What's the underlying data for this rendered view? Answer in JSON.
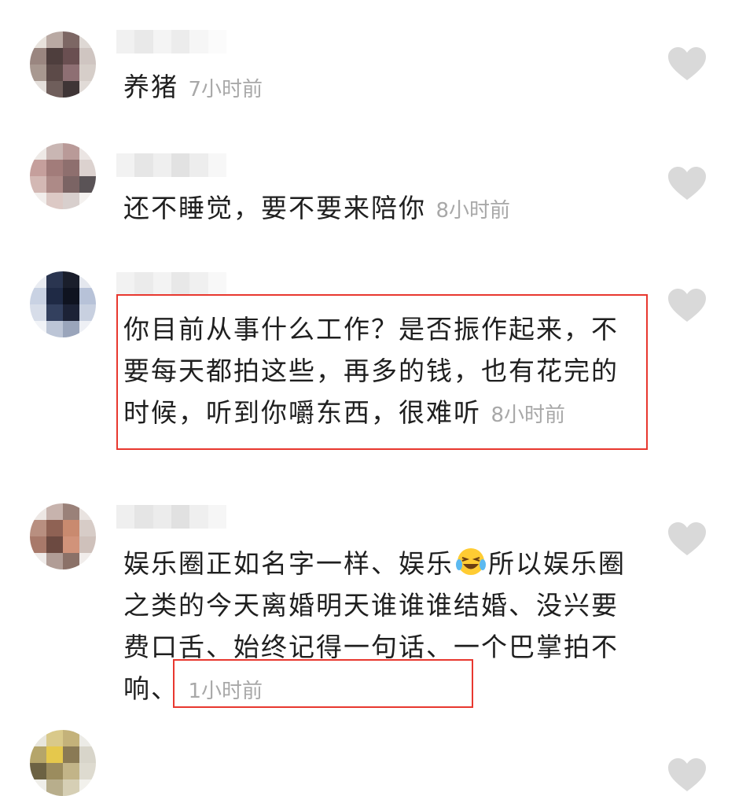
{
  "comments": [
    {
      "text": "养猪",
      "time": "7小时前"
    },
    {
      "text": "还不睡觉，要不要来陪你",
      "time": "8小时前"
    },
    {
      "text": "你目前从事什么工作？是否振作起来，不要每天都拍这些，再多的钱，也有花完的时候，听到你嚼东西，很难听",
      "time": "8小时前"
    },
    {
      "text_a": "娱乐圈正如名字一样、娱乐",
      "emoji": "laughing-tears-emoji",
      "text_b": "所以娱乐圈之类的今天离婚明天谁谁谁结婚、没兴要费口舌、始终记得一句话、一个巴掌拍不响、",
      "time": "1小时前"
    }
  ],
  "colors": {
    "highlight_border": "#e8382f",
    "time_text": "#a8a8a8",
    "like_icon": "#d9d9d9"
  },
  "icons": {
    "like": "heart-icon"
  }
}
